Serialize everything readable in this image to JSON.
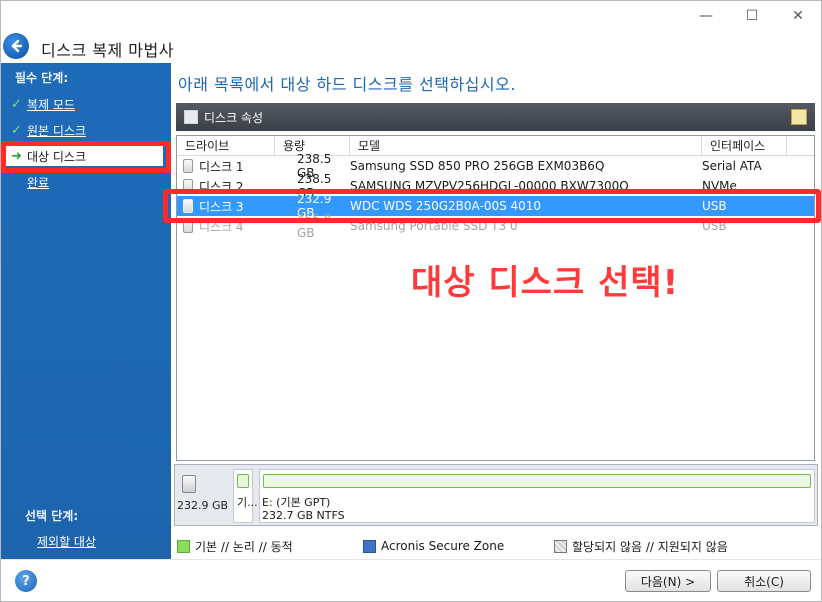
{
  "window": {
    "title": "디스크 복제 마법사",
    "minimize_glyph": "—",
    "maximize_glyph": "☐",
    "close_glyph": "✕"
  },
  "sidebar": {
    "heading": "필수 단계:",
    "steps": [
      {
        "label": "복제 모드",
        "state": "done"
      },
      {
        "label": "원본 디스크",
        "state": "done"
      },
      {
        "label": "대상 디스크",
        "state": "current"
      },
      {
        "label": "완료",
        "state": "pending"
      }
    ],
    "optional_heading": "선택 단계:",
    "optional_items": [
      {
        "label": "제외할 대상"
      }
    ]
  },
  "main": {
    "instruction": "아래 목록에서 대상 하드 디스크를 선택하십시오.",
    "properties_bar_label": "디스크 속성",
    "columns": [
      "드라이브",
      "용량",
      "모델",
      "인터페이스"
    ],
    "disks": [
      {
        "drive": "디스크 1",
        "capacity": "238.5 GB",
        "model": "Samsung SSD 850 PRO 256GB EXM03B6Q",
        "interface": "Serial ATA",
        "state": "normal"
      },
      {
        "drive": "디스크 2",
        "capacity": "238.5 GB",
        "model": "SAMSUNG MZVPV256HDGL-00000 BXW7300Q",
        "interface": "NVMe",
        "state": "normal"
      },
      {
        "drive": "디스크 3",
        "capacity": "232.9 GB",
        "model": "WDC WDS 250G2B0A-00S 4010",
        "interface": "USB",
        "state": "selected"
      },
      {
        "drive": "디스크 4",
        "capacity": "465.8 GB",
        "model": "Samsung Portable SSD T3 0",
        "interface": "USB",
        "state": "disabled"
      }
    ],
    "annotation": "대상 디스크 선택!"
  },
  "layout_panel": {
    "disk_size": "232.9 GB",
    "small_partition_label": "기...",
    "partition_label": "E: (기본 GPT)",
    "partition_detail": "232.7 GB  NTFS"
  },
  "legend": [
    {
      "label": "기본 // 논리 // 동적",
      "color": "#7ed957"
    },
    {
      "label": "Acronis Secure Zone",
      "color": "#3d74c7"
    },
    {
      "label": "할당되지 않음 // 지원되지 않음",
      "color": "#c9c9c9"
    }
  ],
  "footer": {
    "help_glyph": "?",
    "next_label": "다음(N) >",
    "cancel_label": "취소(C)"
  },
  "colors": {
    "sidebar": "#1e6bb8",
    "accent": "#1f66b4",
    "selection": "#3399ff",
    "highlight": "#ff2b2b"
  }
}
